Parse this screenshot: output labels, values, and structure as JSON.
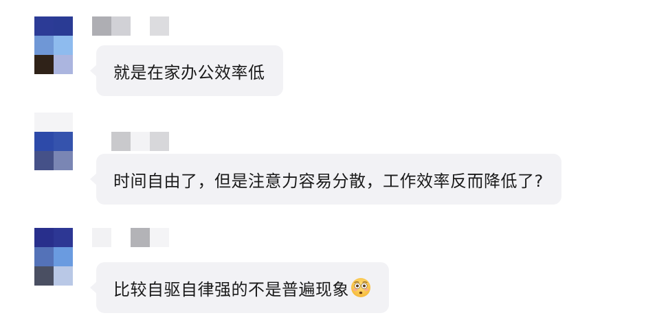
{
  "messages": [
    {
      "sender": "",
      "text": "就是在家办公效率低",
      "avatar_colors": [
        "#2c3b96",
        "#2a3b94",
        "#6f97d6",
        "#8ebbee",
        "#2f2218",
        "#abb5df"
      ],
      "name_colors": [
        "#aeaeb3",
        "#d1d1d6",
        "#ffffff",
        "#dcdcdf"
      ]
    },
    {
      "sender": "",
      "text": "时间自由了，但是注意力容易分散，工作效率反而降低了?",
      "avatar_colors": [
        "#f4f4f6",
        "#f4f4f6",
        "#2d4aa9",
        "#3553ad",
        "#455188",
        "#7a86b4"
      ],
      "name_colors": [
        "#ffffff",
        "#c9c9cc",
        "#f3f3f5",
        "#d7d7da"
      ]
    },
    {
      "sender": "",
      "text": "比较自驱自律强的不是普遍现象",
      "emoji": "flushed-face",
      "avatar_colors": [
        "#282f8c",
        "#2d3794",
        "#5472b8",
        "#6a9be0",
        "#4a4f62",
        "#b9c8e6"
      ],
      "name_colors": [
        "#f2f2f4",
        "#ffffff",
        "#b3b3b7",
        "#f4f4f6"
      ]
    }
  ],
  "colors": {
    "bubble_bg": "#f2f2f5",
    "text": "#1a1a1a",
    "background": "#ffffff"
  }
}
